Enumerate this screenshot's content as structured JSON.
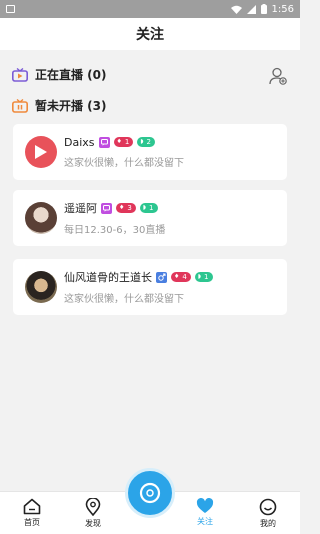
{
  "status_bar": {
    "time": "1:56"
  },
  "header": {
    "title": "关注"
  },
  "sections": {
    "live": {
      "label": "正在直播 (0)"
    },
    "offline": {
      "label": "暂未开播 (3)"
    }
  },
  "cards": [
    {
      "name": "Daixs",
      "level": "1",
      "fans": "2",
      "subtitle": "这家伙很懒，什么都没留下",
      "avatar": "play-icon"
    },
    {
      "name": "遥遥阿",
      "level": "3",
      "fans": "1",
      "subtitle": "每日12.30-6，30直播",
      "avatar": "photo"
    },
    {
      "name": "仙风道骨的王道长",
      "level": "4",
      "fans": "1",
      "subtitle": "这家伙很懒，什么都没留下",
      "avatar": "photo"
    }
  ],
  "tabbar": {
    "home": "首页",
    "discover": "发现",
    "follow": "关注",
    "mine": "我的"
  },
  "colors": {
    "accent": "#2ba4e8",
    "live_icon": "#7c5cd6",
    "offline_icon": "#f08a3c"
  }
}
